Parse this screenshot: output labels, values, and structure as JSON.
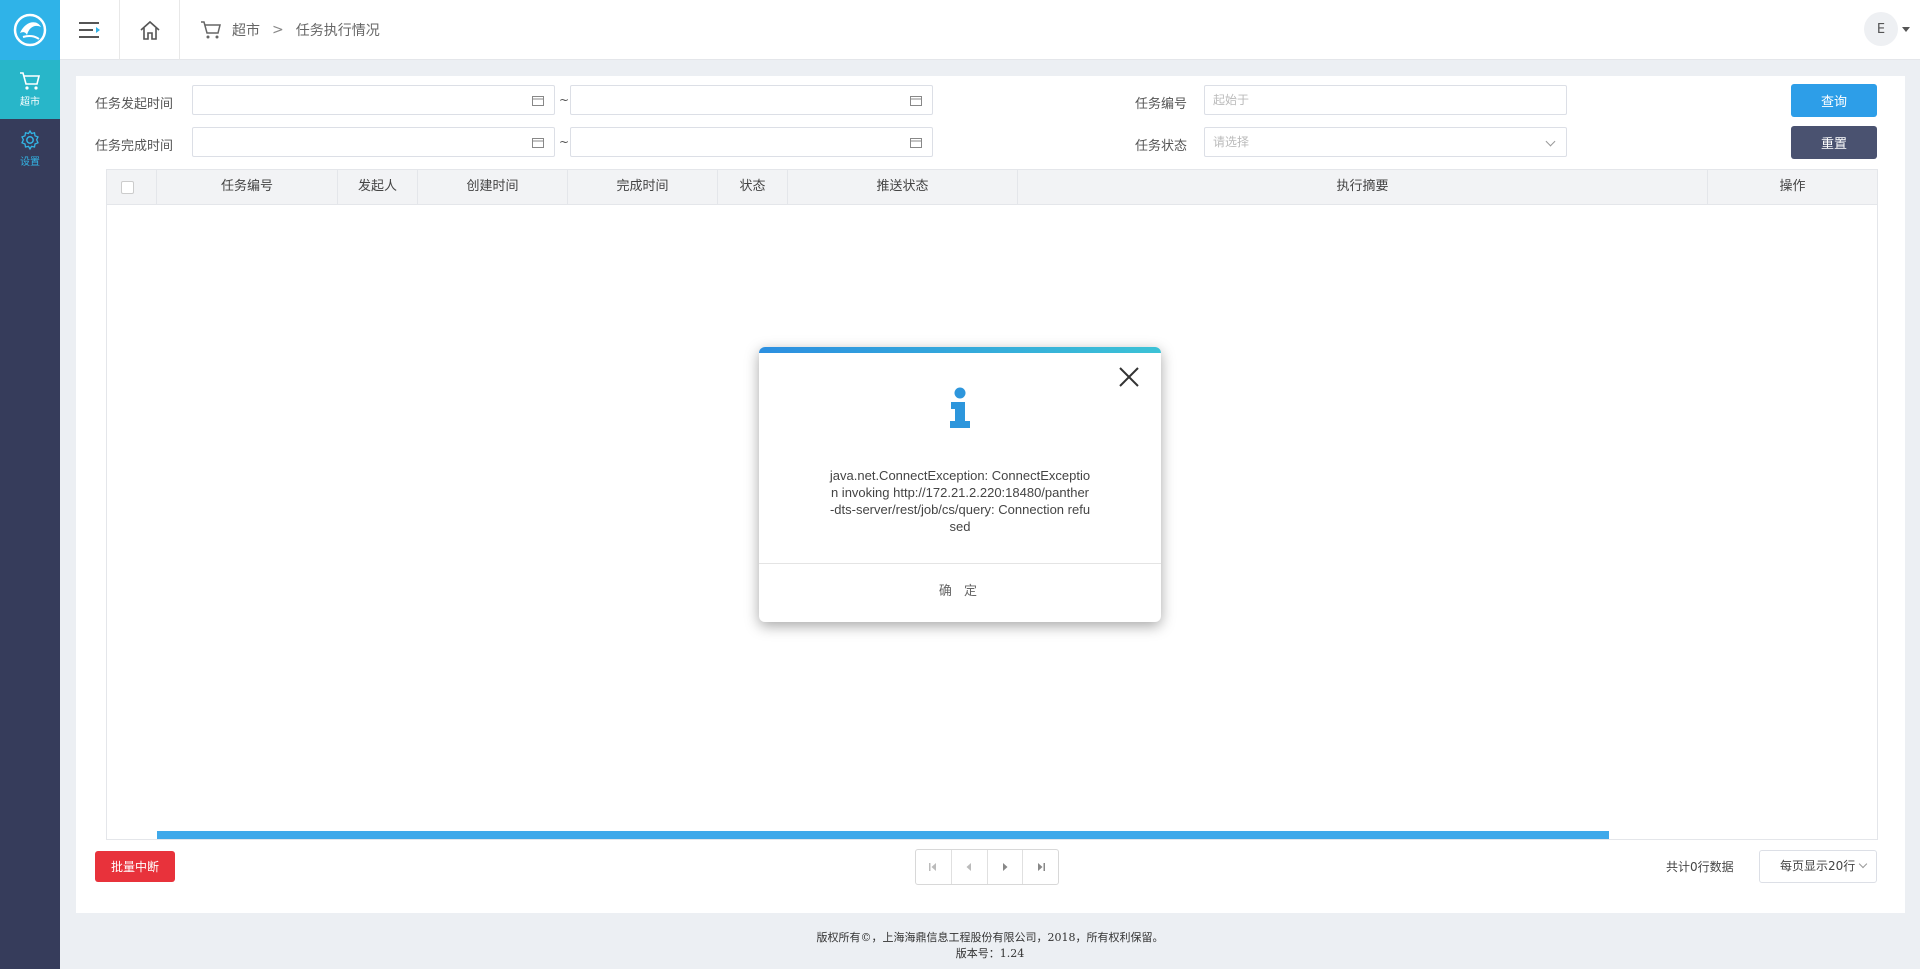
{
  "topbar": {
    "breadcrumb": [
      "超市",
      "任务执行情况"
    ],
    "breadcrumb_sep": ">",
    "user_initial": "E"
  },
  "sidebar": {
    "items": [
      {
        "label": "超市",
        "icon": "cart-icon",
        "active": true
      },
      {
        "label": "设置",
        "icon": "gear-icon",
        "active": false
      }
    ]
  },
  "filters": {
    "start_time_label": "任务发起时间",
    "end_time_label": "任务完成时间",
    "range_sep": "~",
    "task_no_label": "任务编号",
    "task_no_placeholder": "起始于",
    "status_label": "任务状态",
    "status_placeholder": "请选择",
    "query_button": "查询",
    "reset_button": "重置"
  },
  "table": {
    "columns": [
      "任务编号",
      "发起人",
      "创建时间",
      "完成时间",
      "状态",
      "推送状态",
      "执行摘要",
      "操作"
    ],
    "rows": []
  },
  "bottom": {
    "batch_button": "批量中断",
    "total_text": "共计0行数据",
    "page_size": "每页显示20行"
  },
  "footer": {
    "copyright": "版权所有©，上海海鼎信息工程股份有限公司，2018，所有权利保留。",
    "version": "版本号：1.24"
  },
  "modal": {
    "message": "java.net.ConnectException: ConnectException invoking http://172.21.2.220:18480/panther-dts-server/rest/job/cs/query: Connection refused",
    "ok_button": "确 定"
  },
  "colors": {
    "sidebar_bg": "#363c5b",
    "accent": "#2fb3e8",
    "danger": "#e8323b",
    "reset_btn": "#4a5270"
  }
}
